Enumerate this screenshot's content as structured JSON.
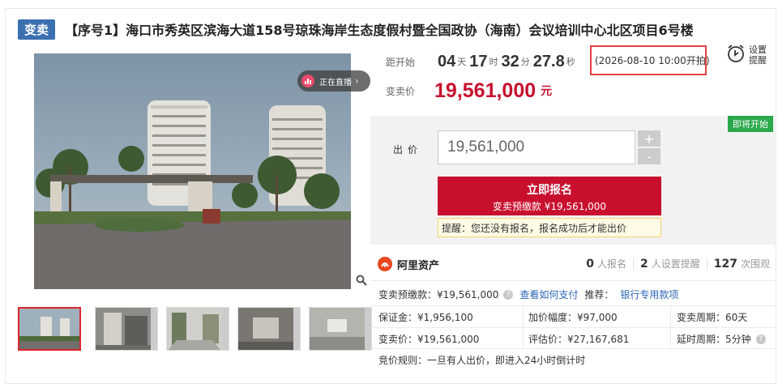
{
  "header": {
    "tag": "变卖",
    "title": "【序号1】海口市秀英区滨海大道158号琼珠海岸生态度假村暨全国政协（海南）会议培训中心北区项目6号楼"
  },
  "gallery": {
    "live_label": "正在直播",
    "thumbnail_count": 5
  },
  "countdown": {
    "label": "距开始",
    "days": "04",
    "days_unit": "天",
    "hours": "17",
    "hours_unit": "时",
    "minutes": "32",
    "minutes_unit": "分",
    "seconds": "27.8",
    "seconds_unit": "秒",
    "start_time": "(2026-08-10 10:00开拍)"
  },
  "price": {
    "label": "变卖价",
    "value": "19,561,000",
    "unit": "元"
  },
  "settings": {
    "line1": "设置",
    "line2": "提醒"
  },
  "bid": {
    "status_badge": "即将开始",
    "label": "出价",
    "input_value": "19,561,000",
    "plus": "+",
    "minus": "-",
    "register_label": "立即报名",
    "register_sub": "变卖预缴款 ¥19,561,000",
    "tip": "提醒：您还没有报名，报名成功后才能出价"
  },
  "platform": {
    "name": "阿里资产",
    "registered_count": "0",
    "registered_label": "人报名",
    "reminders_count": "2",
    "reminders_label": "人设置提醒",
    "views_count": "127",
    "views_label": "次围观"
  },
  "details": {
    "deposit_label": "变卖预缴款：¥19,561,000",
    "how_to_pay": "查看如何支付",
    "recommend_label": "推荐：",
    "bank_link": "银行专用款项",
    "margin": "保证金：¥1,956,100",
    "increment": "加价幅度：¥97,000",
    "period": "变卖周期：60天",
    "sale_price": "变卖价：¥19,561,000",
    "appraisal": "评估价：¥27,167,681",
    "delay": "延时周期：5分钟",
    "rule": "竞价规则：一旦有人出价，即进入24小时倒计时"
  },
  "colors": {
    "accent_red": "#c8102e",
    "tag_blue": "#3a6fb0",
    "status_green": "#2aa84a",
    "link_blue": "#2b65b5"
  }
}
